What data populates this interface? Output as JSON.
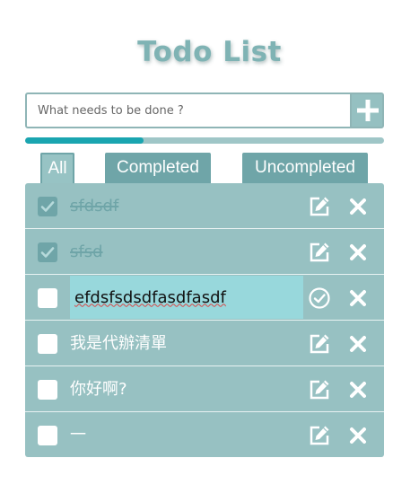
{
  "title": "Todo List",
  "input": {
    "placeholder": "What needs to be done ?",
    "value": ""
  },
  "progress": {
    "fraction": 0.33
  },
  "tabs": [
    {
      "label": "All",
      "active": true
    },
    {
      "label": "Completed",
      "active": false
    },
    {
      "label": "Uncompleted",
      "active": false
    }
  ],
  "todos": [
    {
      "text": "sfdsdf",
      "completed": true,
      "editing": false
    },
    {
      "text": "sfsd",
      "completed": true,
      "editing": false
    },
    {
      "text": "efdsfsdsdfasdfasdf",
      "completed": false,
      "editing": true
    },
    {
      "text": "我是代辦清單",
      "completed": false,
      "editing": false
    },
    {
      "text": "你好啊?",
      "completed": false,
      "editing": false
    },
    {
      "text": "一",
      "completed": false,
      "editing": false
    }
  ],
  "colors": {
    "accent": "#1aa5b0",
    "item_bg": "#97c1c2",
    "tab_bg": "#6fa5a8",
    "done_text": "#6fa5a8"
  },
  "icons": {
    "add": "plus-icon",
    "edit": "edit-icon",
    "confirm": "check-circle-icon",
    "delete": "close-icon",
    "checkbox": "checkbox-icon"
  }
}
